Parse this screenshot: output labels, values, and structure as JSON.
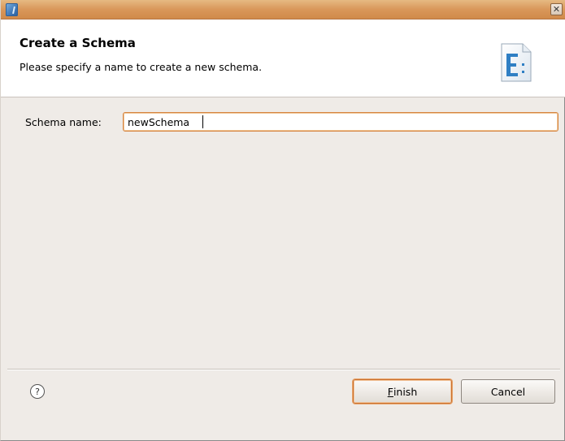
{
  "window": {
    "close_glyph": "✕",
    "app_icon": "eclipse-app-icon"
  },
  "banner": {
    "title": "Create a Schema",
    "description": "Please specify a name to create a new schema.",
    "icon": "schema-wizard-icon"
  },
  "form": {
    "schema_name_label": "Schema name:",
    "schema_name_value": "newSchema"
  },
  "footer": {
    "help_glyph": "?",
    "finish_mnemonic": "F",
    "finish_rest": "inish",
    "cancel_label": "Cancel"
  },
  "colors": {
    "titlebar": "#d9975a",
    "focus_border": "#d6843f",
    "dialog_bg": "#efebe7"
  }
}
